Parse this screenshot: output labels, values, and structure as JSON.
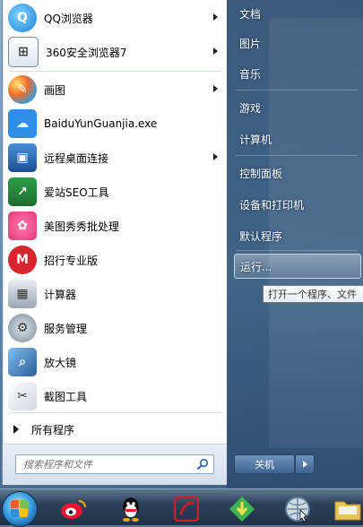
{
  "programs": [
    {
      "label": "QQ浏览器",
      "icon": "qq-browser-icon",
      "submenu": true
    },
    {
      "label": "360安全浏览器7",
      "icon": "360-browser-icon",
      "submenu": true
    },
    {
      "label": "画图",
      "icon": "paint-icon",
      "submenu": true
    },
    {
      "label": "BaiduYunGuanjia.exe",
      "icon": "baidu-cloud-icon",
      "submenu": false
    },
    {
      "label": "远程桌面连接",
      "icon": "remote-desktop-icon",
      "submenu": true
    },
    {
      "label": "爱站SEO工具",
      "icon": "aizhan-seo-icon",
      "submenu": false
    },
    {
      "label": "美图秀秀批处理",
      "icon": "meitu-icon",
      "submenu": false
    },
    {
      "label": "招行专业版",
      "icon": "cmb-bank-icon",
      "submenu": false
    },
    {
      "label": "计算器",
      "icon": "calculator-icon",
      "submenu": false
    },
    {
      "label": "服务管理",
      "icon": "services-icon",
      "submenu": false
    },
    {
      "label": "放大镜",
      "icon": "magnifier-icon",
      "submenu": false
    },
    {
      "label": "截图工具",
      "icon": "snipping-tool-icon",
      "submenu": false
    }
  ],
  "all_programs_label": "所有程序",
  "search": {
    "placeholder": "搜索程序和文件"
  },
  "right_items": [
    "文档",
    "图片",
    "音乐",
    "游戏",
    "计算机",
    "控制面板",
    "设备和打印机",
    "默认程序"
  ],
  "run_label": "运行...",
  "tooltip": "打开一个程序、文件",
  "shutdown_label": "关机",
  "taskbar": [
    "weibo-icon",
    "qq-icon",
    "app-red-icon",
    "download-arrow-icon",
    "browser-globe-icon",
    "folder-icon"
  ]
}
